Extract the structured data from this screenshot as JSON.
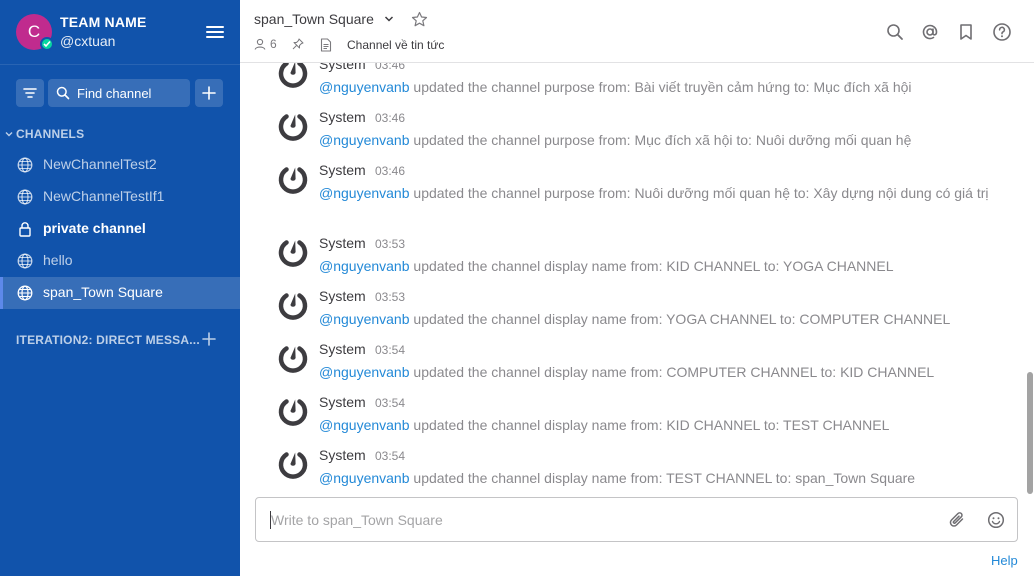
{
  "team": {
    "initial": "C",
    "name": "TEAM NAME",
    "username": "@cxtuan"
  },
  "sidebar": {
    "search_label": "Find channel",
    "channels_section": "CHANNELS",
    "channels": [
      {
        "label": "NewChannelTest2",
        "type": "public"
      },
      {
        "label": "NewChannelTestIf1",
        "type": "public"
      },
      {
        "label": "private channel",
        "type": "private"
      },
      {
        "label": "hello",
        "type": "public"
      },
      {
        "label": "span_Town Square",
        "type": "public",
        "active": true
      }
    ],
    "dm_section": "ITERATION2: DIRECT MESSA..."
  },
  "header": {
    "channel_name": "span_Town Square",
    "member_count": "6",
    "purpose": "Channel về tin tức"
  },
  "posts": [
    {
      "author": "System",
      "time": "03:46",
      "mention": "@nguyenvanb",
      "text": " updated the channel purpose from: Bài viết truyền cảm hứng to: Mục đích xã hội"
    },
    {
      "author": "System",
      "time": "03:46",
      "mention": "@nguyenvanb",
      "text": " updated the channel purpose from: Mục đích xã hội to: Nuôi dưỡng mối quan hệ"
    },
    {
      "author": "System",
      "time": "03:46",
      "mention": "@nguyenvanb",
      "text": " updated the channel purpose from: Nuôi dưỡng mối quan hệ to: Xây dựng nội dung có giá trị"
    },
    {
      "author": "System",
      "time": "03:53",
      "mention": "@nguyenvanb",
      "text": " updated the channel display name from: KID CHANNEL to: YOGA CHANNEL"
    },
    {
      "author": "System",
      "time": "03:53",
      "mention": "@nguyenvanb",
      "text": " updated the channel display name from: YOGA CHANNEL to: COMPUTER CHANNEL"
    },
    {
      "author": "System",
      "time": "03:54",
      "mention": "@nguyenvanb",
      "text": " updated the channel display name from: COMPUTER CHANNEL to: KID CHANNEL"
    },
    {
      "author": "System",
      "time": "03:54",
      "mention": "@nguyenvanb",
      "text": " updated the channel display name from: KID CHANNEL to: TEST CHANNEL"
    },
    {
      "author": "System",
      "time": "03:54",
      "mention": "@nguyenvanb",
      "text": " updated the channel display name from: TEST CHANNEL to: span_Town Square"
    }
  ],
  "input": {
    "placeholder": "Write to span_Town Square"
  },
  "help": "Help",
  "colors": {
    "sidebar": "#1153ab",
    "avatar": "#c02b8e",
    "online": "#06d6a0",
    "link": "#2389d7"
  }
}
